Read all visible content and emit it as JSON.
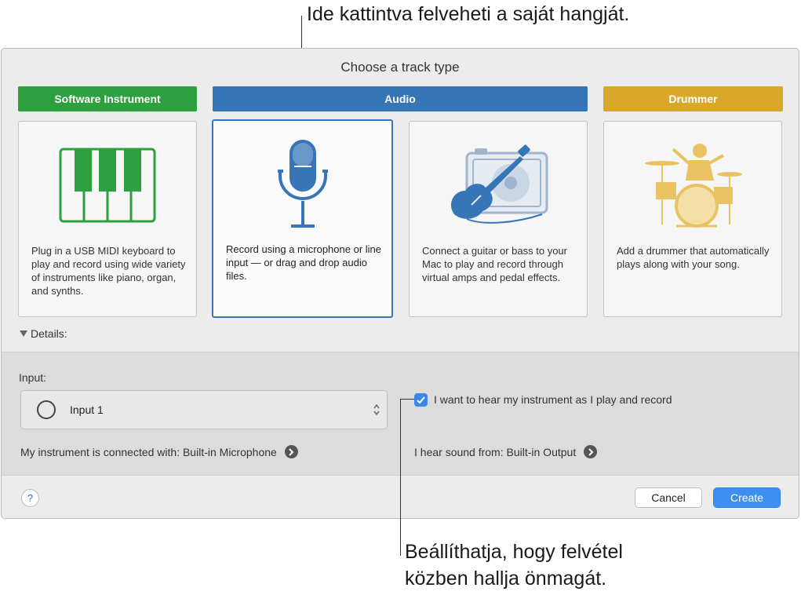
{
  "callouts": {
    "top": "Ide kattintva felveheti a saját hangját.",
    "bottom_line1": "Beállíthatja, hogy felvétel",
    "bottom_line2": "közben hallja önmagát."
  },
  "dialog": {
    "title": "Choose a track type",
    "track_types": {
      "software_instrument": "Software Instrument",
      "audio": "Audio",
      "drummer": "Drummer"
    },
    "selected_track_type": "Audio",
    "cards": {
      "software_instrument": "Plug in a USB MIDI keyboard to play and record using wide variety of instruments like piano, organ, and synths.",
      "audio_mic": "Record using a microphone or line input — or drag and drop audio files.",
      "audio_guitar": "Connect a guitar or bass to your Mac to play and record through virtual amps and pedal effects.",
      "drummer": "Add a drummer that automatically plays along with your song."
    },
    "details_label": "Details:",
    "details_expanded": true,
    "input": {
      "label": "Input:",
      "value": "Input 1"
    },
    "monitor_checkbox": {
      "label": "I want to hear my instrument as I play and record",
      "checked": true
    },
    "connected_with": "My instrument is connected with: Built-in Microphone",
    "hear_from": "I hear sound from: Built-in Output",
    "buttons": {
      "help": "?",
      "cancel": "Cancel",
      "create": "Create"
    }
  },
  "colors": {
    "software_instrument": "#2ea040",
    "audio": "#3676b6",
    "drummer": "#d9a82a",
    "create_button": "#3d8ff0"
  },
  "icons": [
    "piano-keyboard-icon",
    "microphone-icon",
    "guitar-amp-icon",
    "drummer-icon",
    "help-icon",
    "arrow-circle-icon",
    "checkmark-icon",
    "up-down-chevron-icon",
    "disclosure-triangle-icon"
  ]
}
